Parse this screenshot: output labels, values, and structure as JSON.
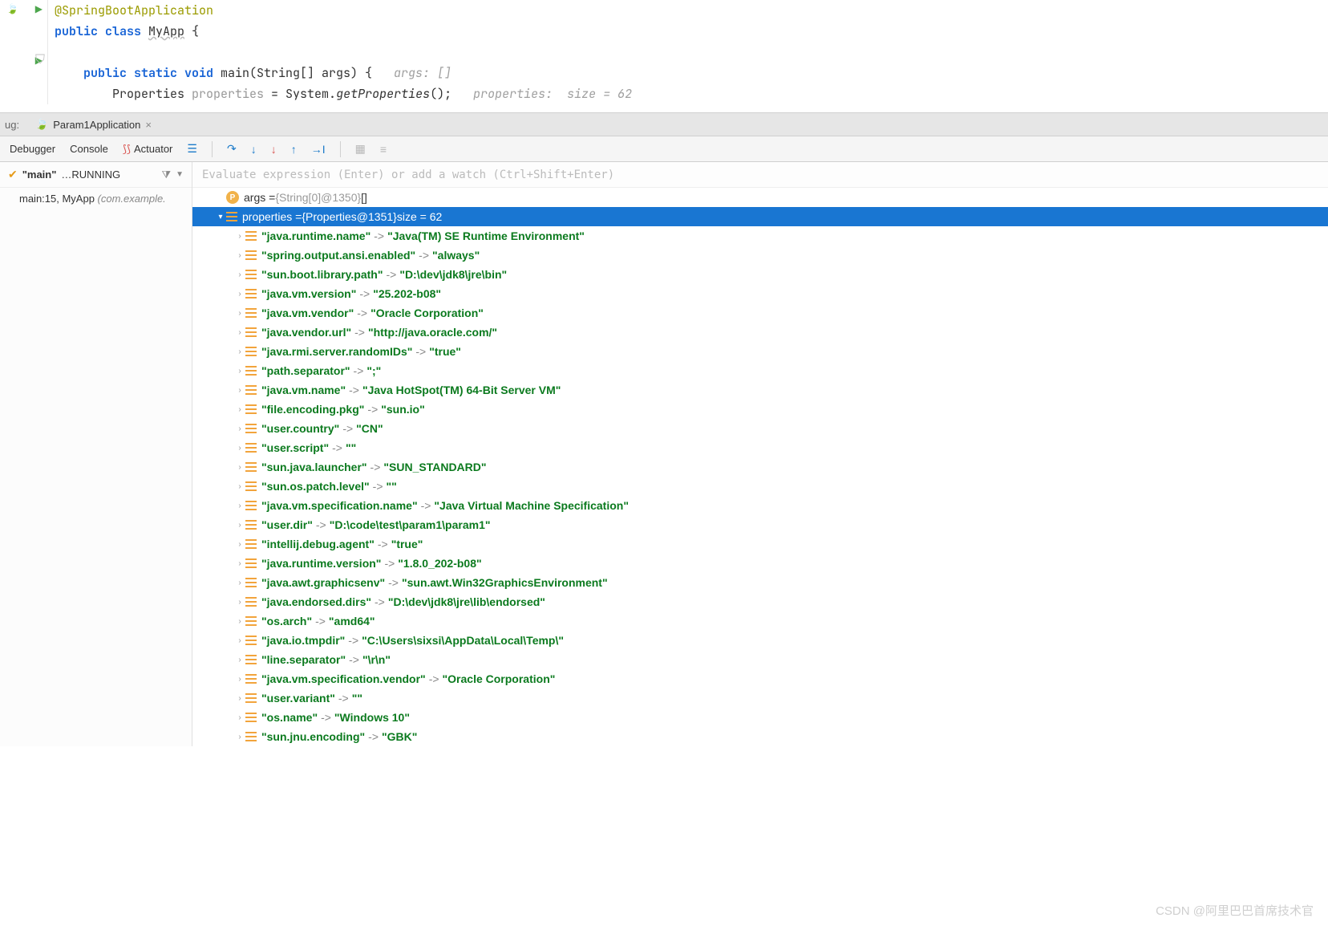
{
  "code": {
    "annotation": "@SpringBootApplication",
    "line1_pre": "public class ",
    "class_name": "MyApp",
    "line1_post": " {",
    "main_sig": "public static void main(String[] args) {   ",
    "main_hint": "args: []",
    "props_line_a": "Properties ",
    "props_line_b": "properties",
    "props_line_c": " = System.",
    "props_line_d": "getProperties",
    "props_line_e": "();   ",
    "props_hint": "properties:  size = 62"
  },
  "tabs": {
    "prefix": "ug:",
    "run_tab": "Param1Application"
  },
  "debug_tabs": {
    "debugger": "Debugger",
    "console": "Console",
    "actuator": "Actuator"
  },
  "thread": {
    "name": "\"main\"",
    "status": "…RUNNING"
  },
  "frame": {
    "label": "main:15, MyApp ",
    "pkg": "(com.example."
  },
  "eval_placeholder": "Evaluate expression (Enter) or add a watch (Ctrl+Shift+Enter)",
  "vars": {
    "args_label": "args = ",
    "args_ref": "{String[0]@1350}",
    "args_val": " []",
    "props_label": "properties = ",
    "props_ref": "{Properties@1351}",
    "props_size": "  size = 62"
  },
  "entries": [
    {
      "k": "\"java.runtime.name\"",
      "v": "\"Java(TM) SE Runtime Environment\""
    },
    {
      "k": "\"spring.output.ansi.enabled\"",
      "v": "\"always\""
    },
    {
      "k": "\"sun.boot.library.path\"",
      "v": "\"D:\\dev\\jdk8\\jre\\bin\""
    },
    {
      "k": "\"java.vm.version\"",
      "v": "\"25.202-b08\""
    },
    {
      "k": "\"java.vm.vendor\"",
      "v": "\"Oracle Corporation\""
    },
    {
      "k": "\"java.vendor.url\"",
      "v": "\"http://java.oracle.com/\""
    },
    {
      "k": "\"java.rmi.server.randomIDs\"",
      "v": "\"true\""
    },
    {
      "k": "\"path.separator\"",
      "v": "\";\""
    },
    {
      "k": "\"java.vm.name\"",
      "v": "\"Java HotSpot(TM) 64-Bit Server VM\""
    },
    {
      "k": "\"file.encoding.pkg\"",
      "v": "\"sun.io\""
    },
    {
      "k": "\"user.country\"",
      "v": "\"CN\""
    },
    {
      "k": "\"user.script\"",
      "v": "\"\""
    },
    {
      "k": "\"sun.java.launcher\"",
      "v": "\"SUN_STANDARD\""
    },
    {
      "k": "\"sun.os.patch.level\"",
      "v": "\"\""
    },
    {
      "k": "\"java.vm.specification.name\"",
      "v": "\"Java Virtual Machine Specification\""
    },
    {
      "k": "\"user.dir\"",
      "v": "\"D:\\code\\test\\param1\\param1\""
    },
    {
      "k": "\"intellij.debug.agent\"",
      "v": "\"true\""
    },
    {
      "k": "\"java.runtime.version\"",
      "v": "\"1.8.0_202-b08\""
    },
    {
      "k": "\"java.awt.graphicsenv\"",
      "v": "\"sun.awt.Win32GraphicsEnvironment\""
    },
    {
      "k": "\"java.endorsed.dirs\"",
      "v": "\"D:\\dev\\jdk8\\jre\\lib\\endorsed\""
    },
    {
      "k": "\"os.arch\"",
      "v": "\"amd64\""
    },
    {
      "k": "\"java.io.tmpdir\"",
      "v": "\"C:\\Users\\sixsi\\AppData\\Local\\Temp\\\""
    },
    {
      "k": "\"line.separator\"",
      "v": "\"\\r\\n\""
    },
    {
      "k": "\"java.vm.specification.vendor\"",
      "v": "\"Oracle Corporation\""
    },
    {
      "k": "\"user.variant\"",
      "v": "\"\""
    },
    {
      "k": "\"os.name\"",
      "v": "\"Windows 10\""
    },
    {
      "k": "\"sun.jnu.encoding\"",
      "v": "\"GBK\""
    }
  ],
  "watermark": "CSDN @阿里巴巴首席技术官"
}
